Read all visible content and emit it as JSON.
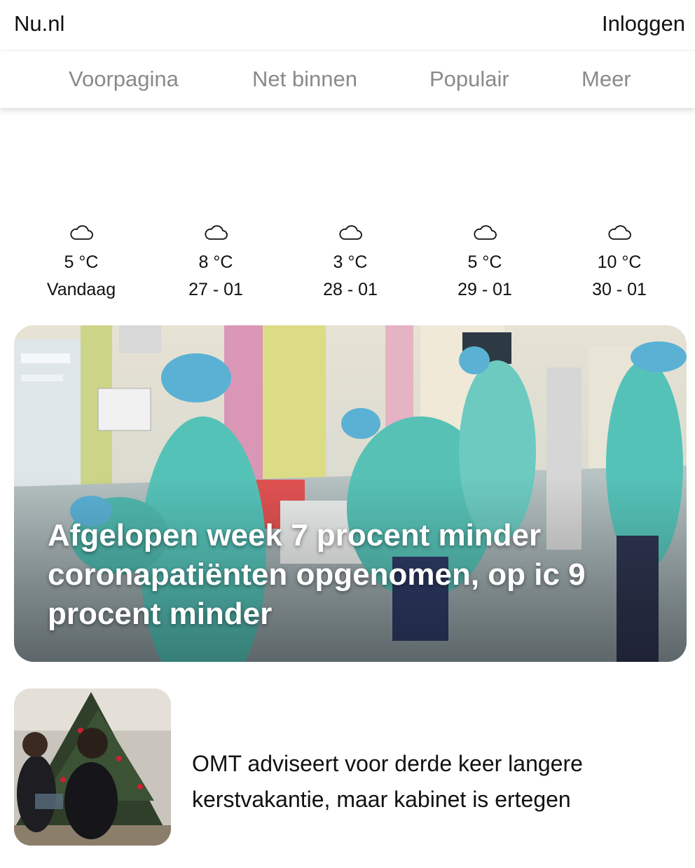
{
  "header": {
    "logo": "Nu.nl",
    "login_label": "Inloggen"
  },
  "nav": {
    "items": [
      {
        "label": "Voorpagina"
      },
      {
        "label": "Net binnen"
      },
      {
        "label": "Populair"
      },
      {
        "label": "Meer"
      }
    ]
  },
  "weather": {
    "icon": "cloud-icon",
    "days": [
      {
        "temp": "5 °C",
        "date": "Vandaag"
      },
      {
        "temp": "8 °C",
        "date": "27 - 01"
      },
      {
        "temp": "3 °C",
        "date": "28 - 01"
      },
      {
        "temp": "5 °C",
        "date": "29 - 01"
      },
      {
        "temp": "10 °C",
        "date": "30 - 01"
      }
    ]
  },
  "hero": {
    "title": "Afgelopen week 7 procent minder coronapatiënten opgenomen, op ic 9 procent minder"
  },
  "articles": [
    {
      "title": "OMT adviseert voor derde keer langere kerstvakantie, maar kabinet is ertegen"
    }
  ],
  "colors": {
    "nav_text": "#8a8a8a",
    "gown": "#55c2b8",
    "cap": "#5ab1d4"
  }
}
